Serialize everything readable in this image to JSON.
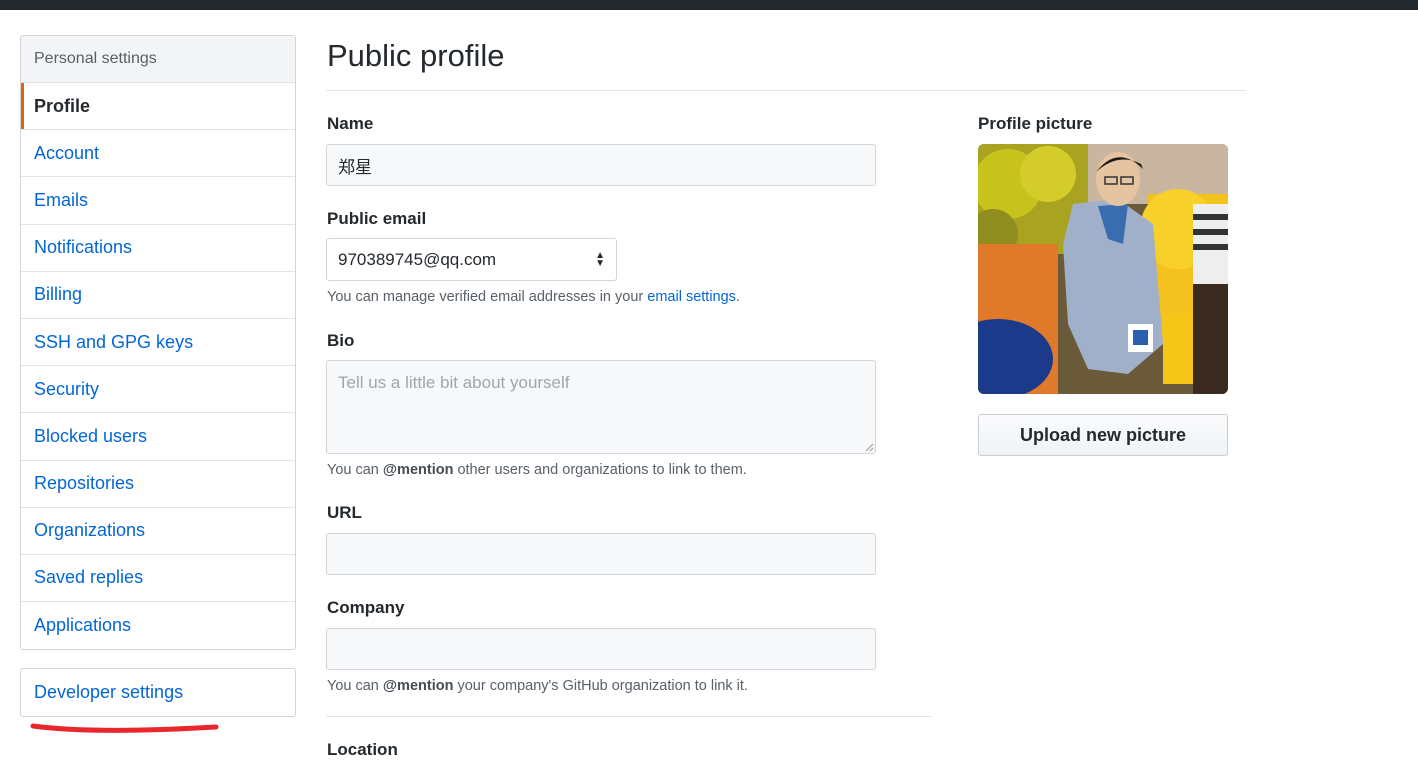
{
  "sidebar": {
    "heading": "Personal settings",
    "items": [
      {
        "label": "Profile",
        "selected": true
      },
      {
        "label": "Account"
      },
      {
        "label": "Emails"
      },
      {
        "label": "Notifications"
      },
      {
        "label": "Billing"
      },
      {
        "label": "SSH and GPG keys"
      },
      {
        "label": "Security"
      },
      {
        "label": "Blocked users"
      },
      {
        "label": "Repositories"
      },
      {
        "label": "Organizations"
      },
      {
        "label": "Saved replies"
      },
      {
        "label": "Applications"
      }
    ],
    "developer_settings": "Developer settings",
    "accent_color": "#e36209",
    "annotation_color": "#e8262b"
  },
  "main": {
    "title": "Public profile",
    "name": {
      "label": "Name",
      "value": "郑星"
    },
    "public_email": {
      "label": "Public email",
      "selected": "970389745@qq.com",
      "note_prefix": "You can manage verified email addresses in your ",
      "note_link": "email settings",
      "note_suffix": "."
    },
    "bio": {
      "label": "Bio",
      "placeholder": "Tell us a little bit about yourself",
      "note_prefix": "You can ",
      "note_mention": "@mention",
      "note_suffix": " other users and organizations to link to them."
    },
    "url": {
      "label": "URL",
      "value": ""
    },
    "company": {
      "label": "Company",
      "value": "",
      "note_prefix": "You can ",
      "note_mention": "@mention",
      "note_suffix": " your company's GitHub organization to link it."
    },
    "location": {
      "label": "Location"
    }
  },
  "profile_picture": {
    "label": "Profile picture",
    "upload_button": "Upload new picture"
  },
  "colors": {
    "link": "#0366d6",
    "text": "#24292e",
    "muted": "#586069",
    "topbar": "#24292e"
  }
}
